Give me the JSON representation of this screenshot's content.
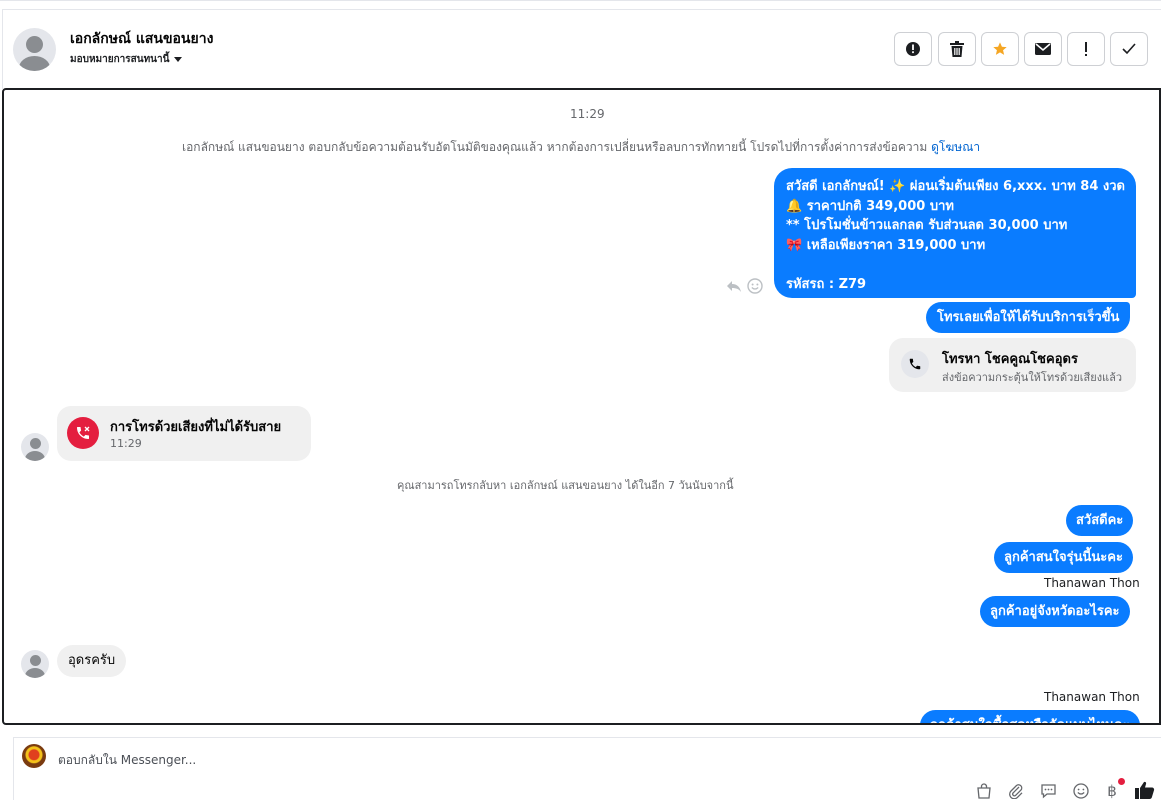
{
  "header": {
    "contact_name": "เอกลักษณ์ แสนขอนยาง",
    "assign_label": "มอบหมายการสนทนานี้",
    "actions": [
      {
        "name": "report-spam",
        "icon": "alert-circle-icon"
      },
      {
        "name": "delete",
        "icon": "trash-icon"
      },
      {
        "name": "star",
        "icon": "star-icon",
        "color": "#f5a623"
      },
      {
        "name": "mark-unread",
        "icon": "envelope-icon"
      },
      {
        "name": "follow-up",
        "icon": "exclamation-icon"
      },
      {
        "name": "mark-done",
        "icon": "check-icon"
      }
    ]
  },
  "chat": {
    "timestamp_top": "11:29",
    "auto_reply_notice": "เอกลักษณ์ แสนขอนยาง ตอบกลับข้อความต้อนรับอัตโนมัติของคุณแล้ว หากต้องการเปลี่ยนหรือลบการทักทายนี้ โปรดไปที่การตั้งค่าการส่งข้อความ",
    "auto_reply_link": "ดูโฆษณา",
    "promo_lines": [
      "สวัสดี เอกลักษณ์! ✨  ผ่อนเริ่มต้นเพียง 6,xxx. บาท 84 งวด",
      "🔔 ราคาปกติ 349,000 บาท",
      "** โปรโมชั่นข้าวแลกลด รับส่วนลด 30,000 บาท",
      "🎀  เหลือเพียงราคา 319,000 บาท",
      "",
      " รหัสรถ : Z79"
    ],
    "cta_message": "โทรเลยเพื่อให้ได้รับบริการเร็วขึ้น",
    "call_card": {
      "title": "โทรหา โชคคูณโชคอุดร",
      "subtitle": "ส่งข้อความกระตุ้นให้โทรด้วยเสียงแล้ว"
    },
    "missed_call": {
      "title": "การโทรด้วยเสียงที่ไม่ได้รับสาย",
      "time": "11:29"
    },
    "callback_notice": "คุณสามารถโทรกลับหา เอกลักษณ์ แสนขอนยาง ได้ในอีก 7 วันนับจากนี้",
    "outgoing": [
      "สวัสดีคะ",
      "ลูกค้าสนใจรุ่นนี้นะคะ",
      "ลูกค้าอยู่จังหวัดอะไรคะ"
    ],
    "sender_name": "Thanawan Thon",
    "incoming_reply": "อุดรครับ",
    "partial_message": "ลูกค้าสนใจซื้อสดหรือจัดแบบไหนคะ"
  },
  "composer": {
    "placeholder": "ตอบกลับใน Messenger...",
    "icons": [
      "bag-icon",
      "paperclip-icon",
      "quick-reply-icon",
      "emoji-icon",
      "baht-icon",
      "thumbs-up-icon"
    ],
    "thumbs_color": "#1c1e21",
    "notify_dot_color": "#e41e3f"
  }
}
